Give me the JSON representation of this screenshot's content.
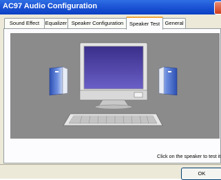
{
  "window": {
    "title": "AC97 Audio Configuration"
  },
  "tabs": [
    {
      "label": "Sound Effect"
    },
    {
      "label": "Equalizer"
    },
    {
      "label": "Speaker Configuration"
    },
    {
      "label": "Speaker Test",
      "active": true
    },
    {
      "label": "General"
    }
  ],
  "speaker_test": {
    "instruction": "Click on the speaker to test it ...",
    "speakers": [
      "left",
      "right"
    ]
  },
  "buttons": {
    "ok": "OK"
  },
  "colors": {
    "titlebar": "#0a3fc4",
    "stage": "#8b8b8b",
    "screen": "#4b3fa3"
  }
}
